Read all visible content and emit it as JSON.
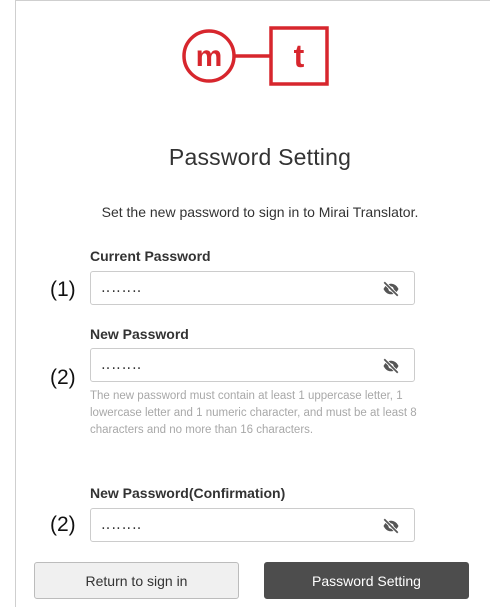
{
  "logo": {
    "letter_left": "m",
    "letter_right": "t",
    "brand_color": "#d7262d"
  },
  "page_title": "Password Setting",
  "subtitle": "Set the new password to sign in to Mirai Translator.",
  "fields": {
    "current": {
      "label": "Current Password",
      "value": "‥‥‥‥",
      "marker": "(1)",
      "icon": "eye-slash-icon"
    },
    "new": {
      "label": "New Password",
      "value": "‥‥‥‥",
      "marker": "(2)",
      "icon": "eye-slash-icon",
      "hint": "The new password must contain at least 1 uppercase letter, 1 lowercase letter and 1 numeric character, and must be at least 8 characters and no more than 16 characters."
    },
    "confirm": {
      "label": "New Password(Confirmation)",
      "value": "‥‥‥‥",
      "marker": "(2)",
      "icon": "eye-slash-icon"
    }
  },
  "buttons": {
    "return_label": "Return to sign in",
    "submit_label": "Password Setting"
  }
}
